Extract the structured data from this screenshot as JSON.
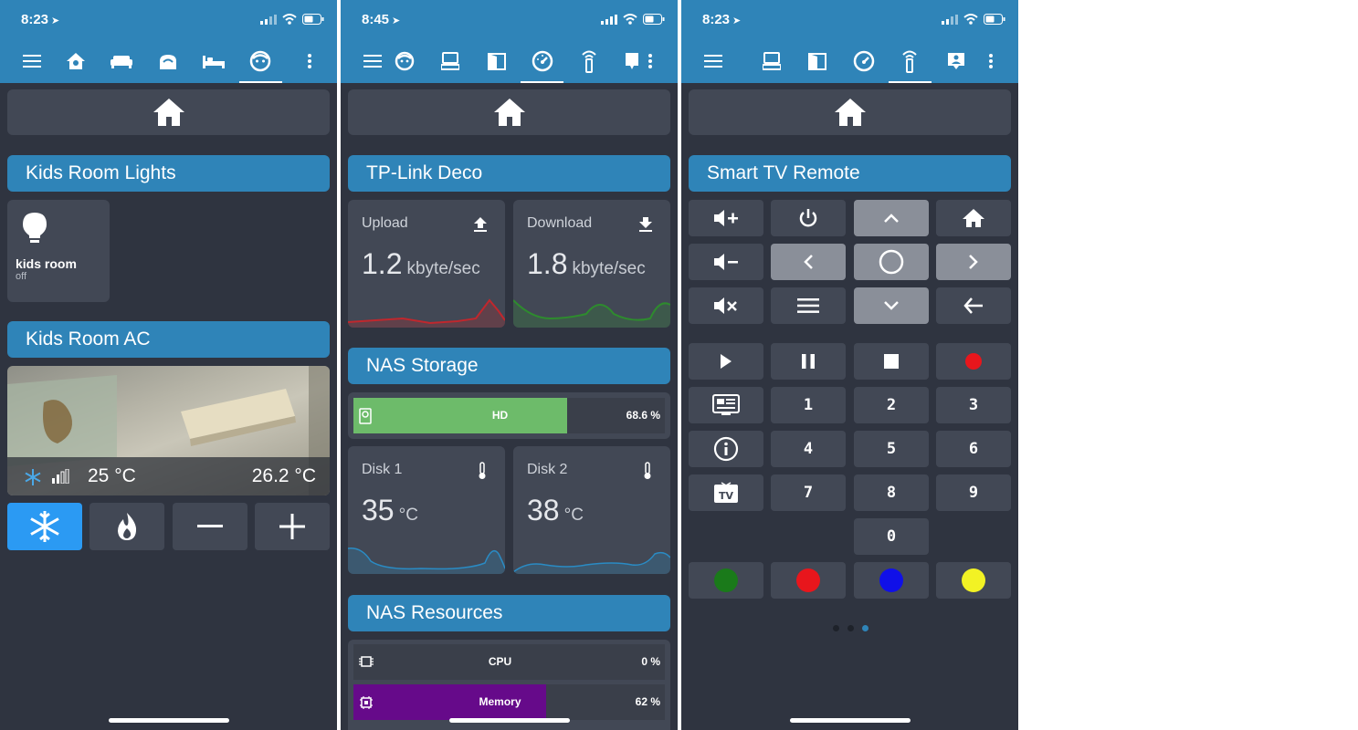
{
  "screens": [
    {
      "time": "8:23",
      "tabs": [
        "menu-icon",
        "house-icon",
        "sofa-icon",
        "router-icon",
        "bed-icon",
        "kid-face-icon",
        "more-icon"
      ],
      "lights_header": "Kids Room Lights",
      "light_tile": {
        "name": "kids room",
        "state": "off"
      },
      "ac_header": "Kids Room AC",
      "ac": {
        "mode_icon": "snowflake-icon",
        "target_temp": "25 °C",
        "current_temp": "26.2 °C"
      },
      "ac_buttons": [
        "snowflake-icon",
        "flame-icon",
        "minus-icon",
        "plus-icon"
      ]
    },
    {
      "time": "8:45",
      "tabs": [
        "menu-icon",
        "kid-face-icon",
        "computer-icon",
        "door-icon",
        "gauge-icon",
        "remote-icon",
        "person-icon",
        "more-icon"
      ],
      "deco_header": "TP-Link Deco",
      "upload": {
        "label": "Upload",
        "value": "1.2",
        "unit": "kbyte/sec",
        "line_color": "#c0272d"
      },
      "download": {
        "label": "Download",
        "value": "1.8",
        "unit": "kbyte/sec",
        "line_color": "#2e8b2e"
      },
      "nas_storage_header": "NAS Storage",
      "hd": {
        "label": "HD",
        "percent_text": "68.6 %",
        "fraction": 0.686,
        "color": "#6dbb6a"
      },
      "disk1": {
        "label": "Disk 1",
        "value": "35",
        "unit": "°C"
      },
      "disk2": {
        "label": "Disk 2",
        "value": "38",
        "unit": "°C"
      },
      "nas_resources_header": "NAS Resources",
      "cpu": {
        "label": "CPU",
        "percent_text": "0 %",
        "fraction": 0.0
      },
      "memory": {
        "label": "Memory",
        "percent_text": "62 %",
        "fraction": 0.62,
        "color": "#660a8a"
      }
    },
    {
      "time": "8:23",
      "tabs": [
        "menu-icon",
        "computer-icon",
        "door-icon",
        "gauge-icon",
        "remote-icon",
        "person-icon",
        "more-icon"
      ],
      "remote_header": "Smart TV Remote",
      "numbers": [
        "1",
        "2",
        "3",
        "4",
        "5",
        "6",
        "7",
        "8",
        "9",
        "0"
      ],
      "color_buttons": [
        "#1a7a1a",
        "#e8161c",
        "#1010e8",
        "#f2f224"
      ]
    }
  ]
}
